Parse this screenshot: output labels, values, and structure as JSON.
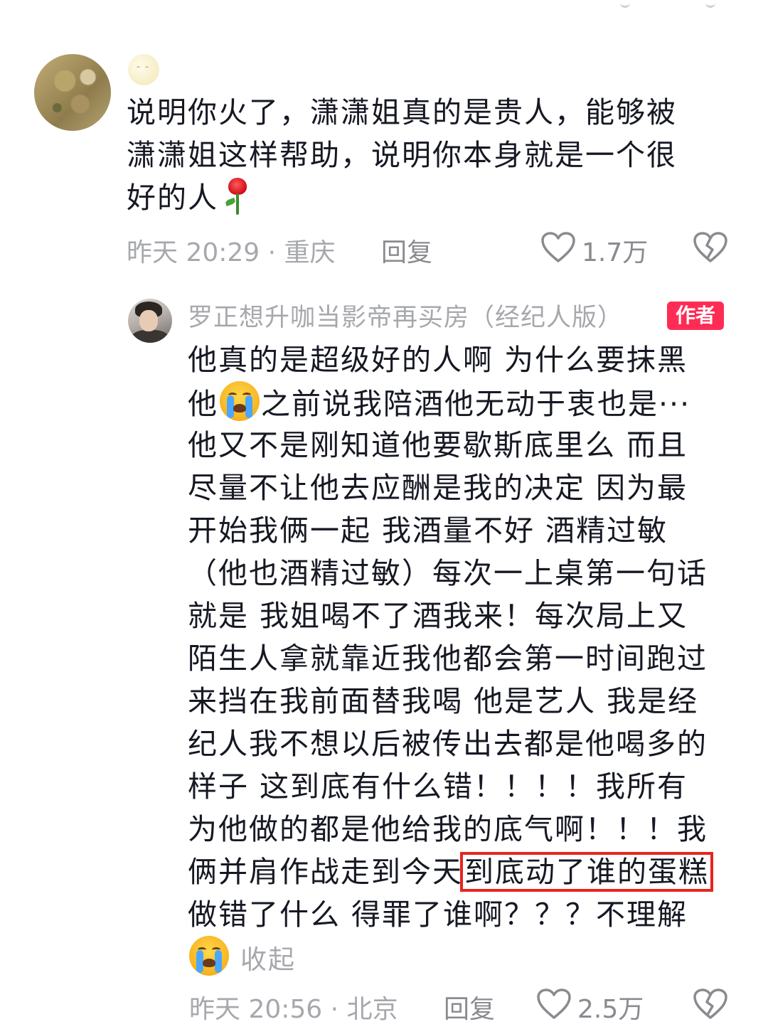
{
  "comments": [
    {
      "text_lines": [
        "说明你火了，潇潇姐真的是贵人，能够被",
        "潇潇姐这样帮助，说明你本身就是一个很",
        "好的人"
      ],
      "emoji": "rose-icon",
      "time": "昨天 20:29",
      "location": "重庆",
      "reply_label": "回复",
      "likes": "1.7万"
    },
    {
      "username": "罗正想升咖当影帝再买房（经纪人版）",
      "badge": "作者",
      "text_lines": [
        "他真的是超级好的人啊 为什么要抹黑",
        "之前说我陪酒他无动于衷也是···",
        "他又不是刚知道他要歇斯底里么 而且",
        "尽量不让他去应酬是我的决定 因为最",
        "开始我俩一起 我酒量不好 酒精过敏",
        "（他也酒精过敏）每次一上桌第一句话",
        "就是 我姐喝不了酒我来！每次局上又",
        "陌生人拿就靠近我他都会第一时间跑过",
        "来挡在我前面替我喝 他是艺人 我是经",
        "纪人我不想以后被传出去都是他喝多的",
        "样子 这到底有什么错！！！！我所有",
        "为他做的都是他给我的底气啊！！！我",
        "俩并肩作战走到今天",
        "做错了什么 得罪了谁啊？？？不理解"
      ],
      "line2_prefix": "他",
      "line13_highlight": "到底动了谁的蛋糕",
      "collapse_label": "收起",
      "time": "昨天 20:56",
      "location": "北京",
      "reply_label": "回复",
      "likes": "2.5万"
    }
  ],
  "separator": "·",
  "colors": {
    "text": "#161823",
    "meta": "#a7a8ad",
    "badge": "#fe2c55",
    "highlight_box": "#e8241e"
  }
}
